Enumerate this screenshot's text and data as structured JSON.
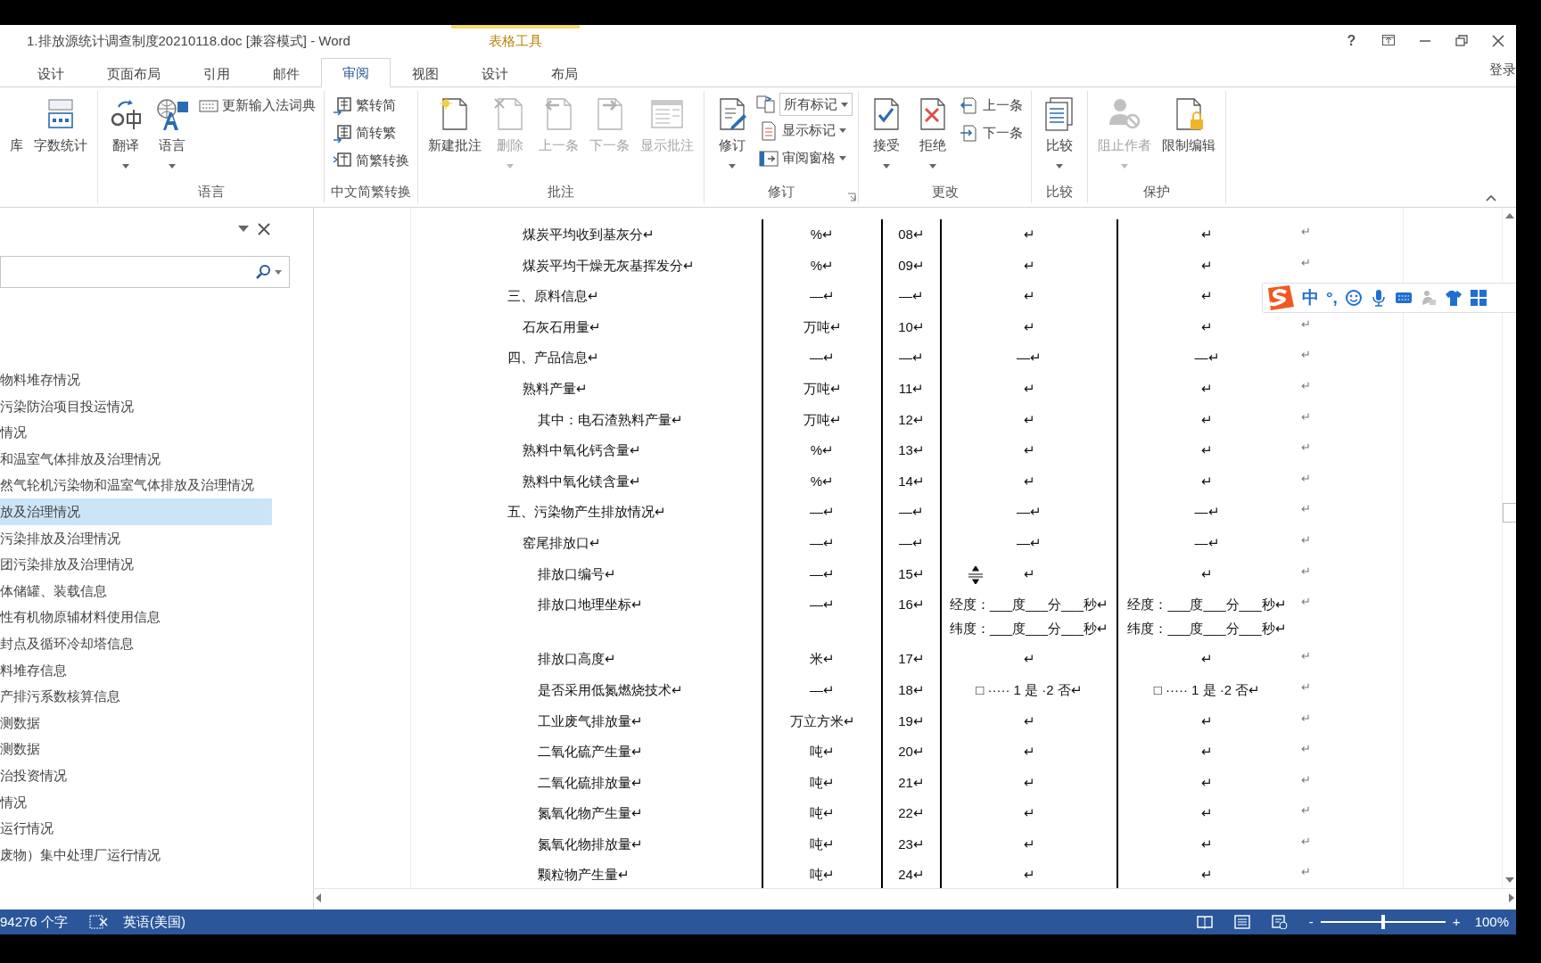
{
  "window": {
    "title": "1.排放源统计调查制度20210118.doc [兼容模式] - Word",
    "context_label": "表格工具",
    "help": "?",
    "account": "登录"
  },
  "tabs": [
    {
      "label": "设计",
      "selected": false
    },
    {
      "label": "页面布局",
      "selected": false
    },
    {
      "label": "引用",
      "selected": false
    },
    {
      "label": "邮件",
      "selected": false
    },
    {
      "label": "审阅",
      "selected": true
    },
    {
      "label": "视图",
      "selected": false
    },
    {
      "label": "设计",
      "selected": false
    },
    {
      "label": "布局",
      "selected": false
    }
  ],
  "ribbon": {
    "groups": [
      {
        "items": [
          {
            "kind": "large",
            "label": "库",
            "disabled": false,
            "dropdown": false
          },
          {
            "kind": "large",
            "label": "字数统计",
            "disabled": false,
            "dropdown": false
          }
        ]
      },
      {
        "label": "语言",
        "items": [
          {
            "kind": "large",
            "label": "翻译",
            "disabled": false,
            "dropdown": true
          },
          {
            "kind": "large",
            "label": "语言",
            "disabled": false,
            "dropdown": true
          },
          {
            "kind": "stack",
            "commands": [
              {
                "kind": "small",
                "label": "更新输入法词典",
                "disabled": false,
                "dropdown": false
              }
            ]
          }
        ]
      },
      {
        "label": "中文简繁转换",
        "items": [
          {
            "kind": "stack",
            "commands": [
              {
                "kind": "small",
                "label": "繁转简",
                "disabled": false,
                "dropdown": false
              },
              {
                "kind": "small",
                "label": "简转繁",
                "disabled": false,
                "dropdown": false
              },
              {
                "kind": "small",
                "label": "简繁转换",
                "disabled": false,
                "dropdown": false
              }
            ]
          }
        ]
      },
      {
        "label": "批注",
        "items": [
          {
            "kind": "large",
            "label": "新建批注",
            "disabled": false,
            "dropdown": false
          },
          {
            "kind": "large",
            "label": "删除",
            "disabled": true,
            "dropdown": true
          },
          {
            "kind": "large",
            "label": "上一条",
            "disabled": true,
            "dropdown": false
          },
          {
            "kind": "large",
            "label": "下一条",
            "disabled": true,
            "dropdown": false
          },
          {
            "kind": "large",
            "label": "显示批注",
            "disabled": true,
            "dropdown": false
          }
        ]
      },
      {
        "label": "修订",
        "launcher": true,
        "items": [
          {
            "kind": "large",
            "label": "修订",
            "disabled": false,
            "dropdown": true
          },
          {
            "kind": "stack",
            "commands": [
              {
                "kind": "select",
                "label": "所有标记",
                "disabled": false,
                "dropdown": true
              },
              {
                "kind": "small",
                "label": "显示标记",
                "disabled": false,
                "dropdown": true
              },
              {
                "kind": "small",
                "label": "审阅窗格",
                "disabled": false,
                "dropdown": true
              }
            ]
          }
        ]
      },
      {
        "label": "更改",
        "items": [
          {
            "kind": "large",
            "label": "接受",
            "disabled": false,
            "dropdown": true
          },
          {
            "kind": "large",
            "label": "拒绝",
            "disabled": false,
            "dropdown": true
          },
          {
            "kind": "stack",
            "commands": [
              {
                "kind": "small",
                "label": "上一条",
                "disabled": false,
                "dropdown": false
              },
              {
                "kind": "small",
                "label": "下一条",
                "disabled": false,
                "dropdown": false
              }
            ]
          }
        ]
      },
      {
        "label": "比较",
        "items": [
          {
            "kind": "large",
            "label": "比较",
            "disabled": false,
            "dropdown": true
          }
        ]
      },
      {
        "label": "保护",
        "items": [
          {
            "kind": "large",
            "label": "阻止作者",
            "disabled": true,
            "dropdown": true
          },
          {
            "kind": "large",
            "label": "限制编辑",
            "disabled": false,
            "dropdown": false
          }
        ]
      }
    ]
  },
  "navigation": {
    "items": [
      {
        "label": "物料堆存情况",
        "selected": false
      },
      {
        "label": "污染防治项目投运情况",
        "selected": false
      },
      {
        "label": "情况",
        "selected": false
      },
      {
        "label": "和温室气体排放及治理情况",
        "selected": false
      },
      {
        "label": "然气轮机污染物和温室气体排放及治理情况",
        "selected": false
      },
      {
        "label": "放及治理情况",
        "selected": true
      },
      {
        "label": "污染排放及治理情况",
        "selected": false
      },
      {
        "label": "团污染排放及治理情况",
        "selected": false
      },
      {
        "label": "体储罐、装载信息",
        "selected": false
      },
      {
        "label": "性有机物原辅材料使用信息",
        "selected": false
      },
      {
        "label": "封点及循环冷却塔信息",
        "selected": false
      },
      {
        "label": "料堆存信息",
        "selected": false
      },
      {
        "label": "产排污系数核算信息",
        "selected": false
      },
      {
        "label": "测数据",
        "selected": false
      },
      {
        "label": "测数据",
        "selected": false
      },
      {
        "label": "治投资情况",
        "selected": false
      },
      {
        "label": "情况",
        "selected": false
      },
      {
        "label": "运行情况",
        "selected": false
      },
      {
        "label": "废物）集中处理厂运行情况",
        "selected": false
      }
    ]
  },
  "document": {
    "rows": [
      {
        "kind": "item",
        "cells": [
          "煤炭平均收到基灰分↵",
          "%↵",
          "08↵",
          "↵",
          "↵"
        ],
        "end": "↵",
        "cursor": false
      },
      {
        "kind": "item",
        "cells": [
          "煤炭平均干燥无灰基挥发分↵",
          "%↵",
          "09↵",
          "↵",
          "↵"
        ],
        "end": "↵",
        "cursor": false
      },
      {
        "kind": "section",
        "cells": [
          "三、原料信息↵",
          "—↵",
          "—↵",
          "↵",
          "↵"
        ],
        "cursor": false
      },
      {
        "kind": "item",
        "cells": [
          "石灰石用量↵",
          "万吨↵",
          "10↵",
          "↵",
          "↵"
        ],
        "end": "↵",
        "cursor": false
      },
      {
        "kind": "section",
        "cells": [
          "四、产品信息↵",
          "—↵",
          "—↵",
          "—↵",
          "—↵"
        ],
        "end": "↵",
        "cursor": false
      },
      {
        "kind": "item",
        "cells": [
          "熟料产量↵",
          "万吨↵",
          "11↵",
          "↵",
          "↵"
        ],
        "end": "↵",
        "cursor": false
      },
      {
        "kind": "subitem",
        "cells": [
          "其中：电石渣熟料产量↵",
          "万吨↵",
          "12↵",
          "↵",
          "↵"
        ],
        "end": "↵",
        "cursor": false
      },
      {
        "kind": "item",
        "cells": [
          "熟料中氧化钙含量↵",
          "%↵",
          "13↵",
          "↵",
          "↵"
        ],
        "end": "↵",
        "cursor": false
      },
      {
        "kind": "item",
        "cells": [
          "熟料中氧化镁含量↵",
          "%↵",
          "14↵",
          "↵",
          "↵"
        ],
        "end": "↵",
        "cursor": false
      },
      {
        "kind": "section",
        "cells": [
          "五、污染物产生排放情况↵",
          "—↵",
          "—↵",
          "—↵",
          "—↵"
        ],
        "end": "↵",
        "cursor": false
      },
      {
        "kind": "item",
        "cells": [
          "窑尾排放口↵",
          "—↵",
          "—↵",
          "—↵",
          "—↵"
        ],
        "end": "↵",
        "cursor": false
      },
      {
        "kind": "subitem",
        "cells": [
          "排放口编号↵",
          "—↵",
          "15↵",
          "↵",
          "↵"
        ],
        "end": "↵",
        "cursor": true
      },
      {
        "kind": "subitem",
        "cells": [
          "排放口地理坐标↵",
          "—↵",
          "16↵",
          "经度：___度___分___秒↵\n纬度：___度___分___秒↵",
          "经度：___度___分___秒↵\n纬度：___度___分___秒↵"
        ],
        "end": "↵",
        "cursor": false
      },
      {
        "kind": "subitem",
        "cells": [
          "排放口高度↵",
          "米↵",
          "17↵",
          "↵",
          "↵"
        ],
        "end": "↵",
        "cursor": false
      },
      {
        "kind": "subitem",
        "cells": [
          "是否采用低氮燃烧技术↵",
          "—↵",
          "18↵",
          "□ ····· 1 是 ·2 否↵",
          "□ ····· 1 是 ·2 否↵"
        ],
        "end": "↵",
        "cursor": false
      },
      {
        "kind": "subitem",
        "cells": [
          "工业废气排放量↵",
          "万立方米↵",
          "19↵",
          "↵",
          "↵"
        ],
        "end": "↵",
        "cursor": false
      },
      {
        "kind": "subitem",
        "cells": [
          "二氧化硫产生量↵",
          "吨↵",
          "20↵",
          "↵",
          "↵"
        ],
        "end": "↵",
        "cursor": false
      },
      {
        "kind": "subitem",
        "cells": [
          "二氧化硫排放量↵",
          "吨↵",
          "21↵",
          "↵",
          "↵"
        ],
        "end": "↵",
        "cursor": false
      },
      {
        "kind": "subitem",
        "cells": [
          "氮氧化物产生量↵",
          "吨↵",
          "22↵",
          "↵",
          "↵"
        ],
        "end": "↵",
        "cursor": false
      },
      {
        "kind": "subitem",
        "cells": [
          "氮氧化物排放量↵",
          "吨↵",
          "23↵",
          "↵",
          "↵"
        ],
        "end": "↵",
        "cursor": false
      },
      {
        "kind": "subitem",
        "cells": [
          "颗粒物产生量↵",
          "吨↵",
          "24↵",
          "↵",
          "↵"
        ],
        "end": "↵",
        "cursor": false
      }
    ]
  },
  "ime_toolbar": {
    "mode": "中",
    "punctuation": "°,"
  },
  "status_bar": {
    "word_count": "94276 个字",
    "language": "英语(美国)",
    "zoom_out": "-",
    "zoom_in": "+",
    "zoom": {
      "level": 0.5
    },
    "zoom_value": "100%"
  }
}
